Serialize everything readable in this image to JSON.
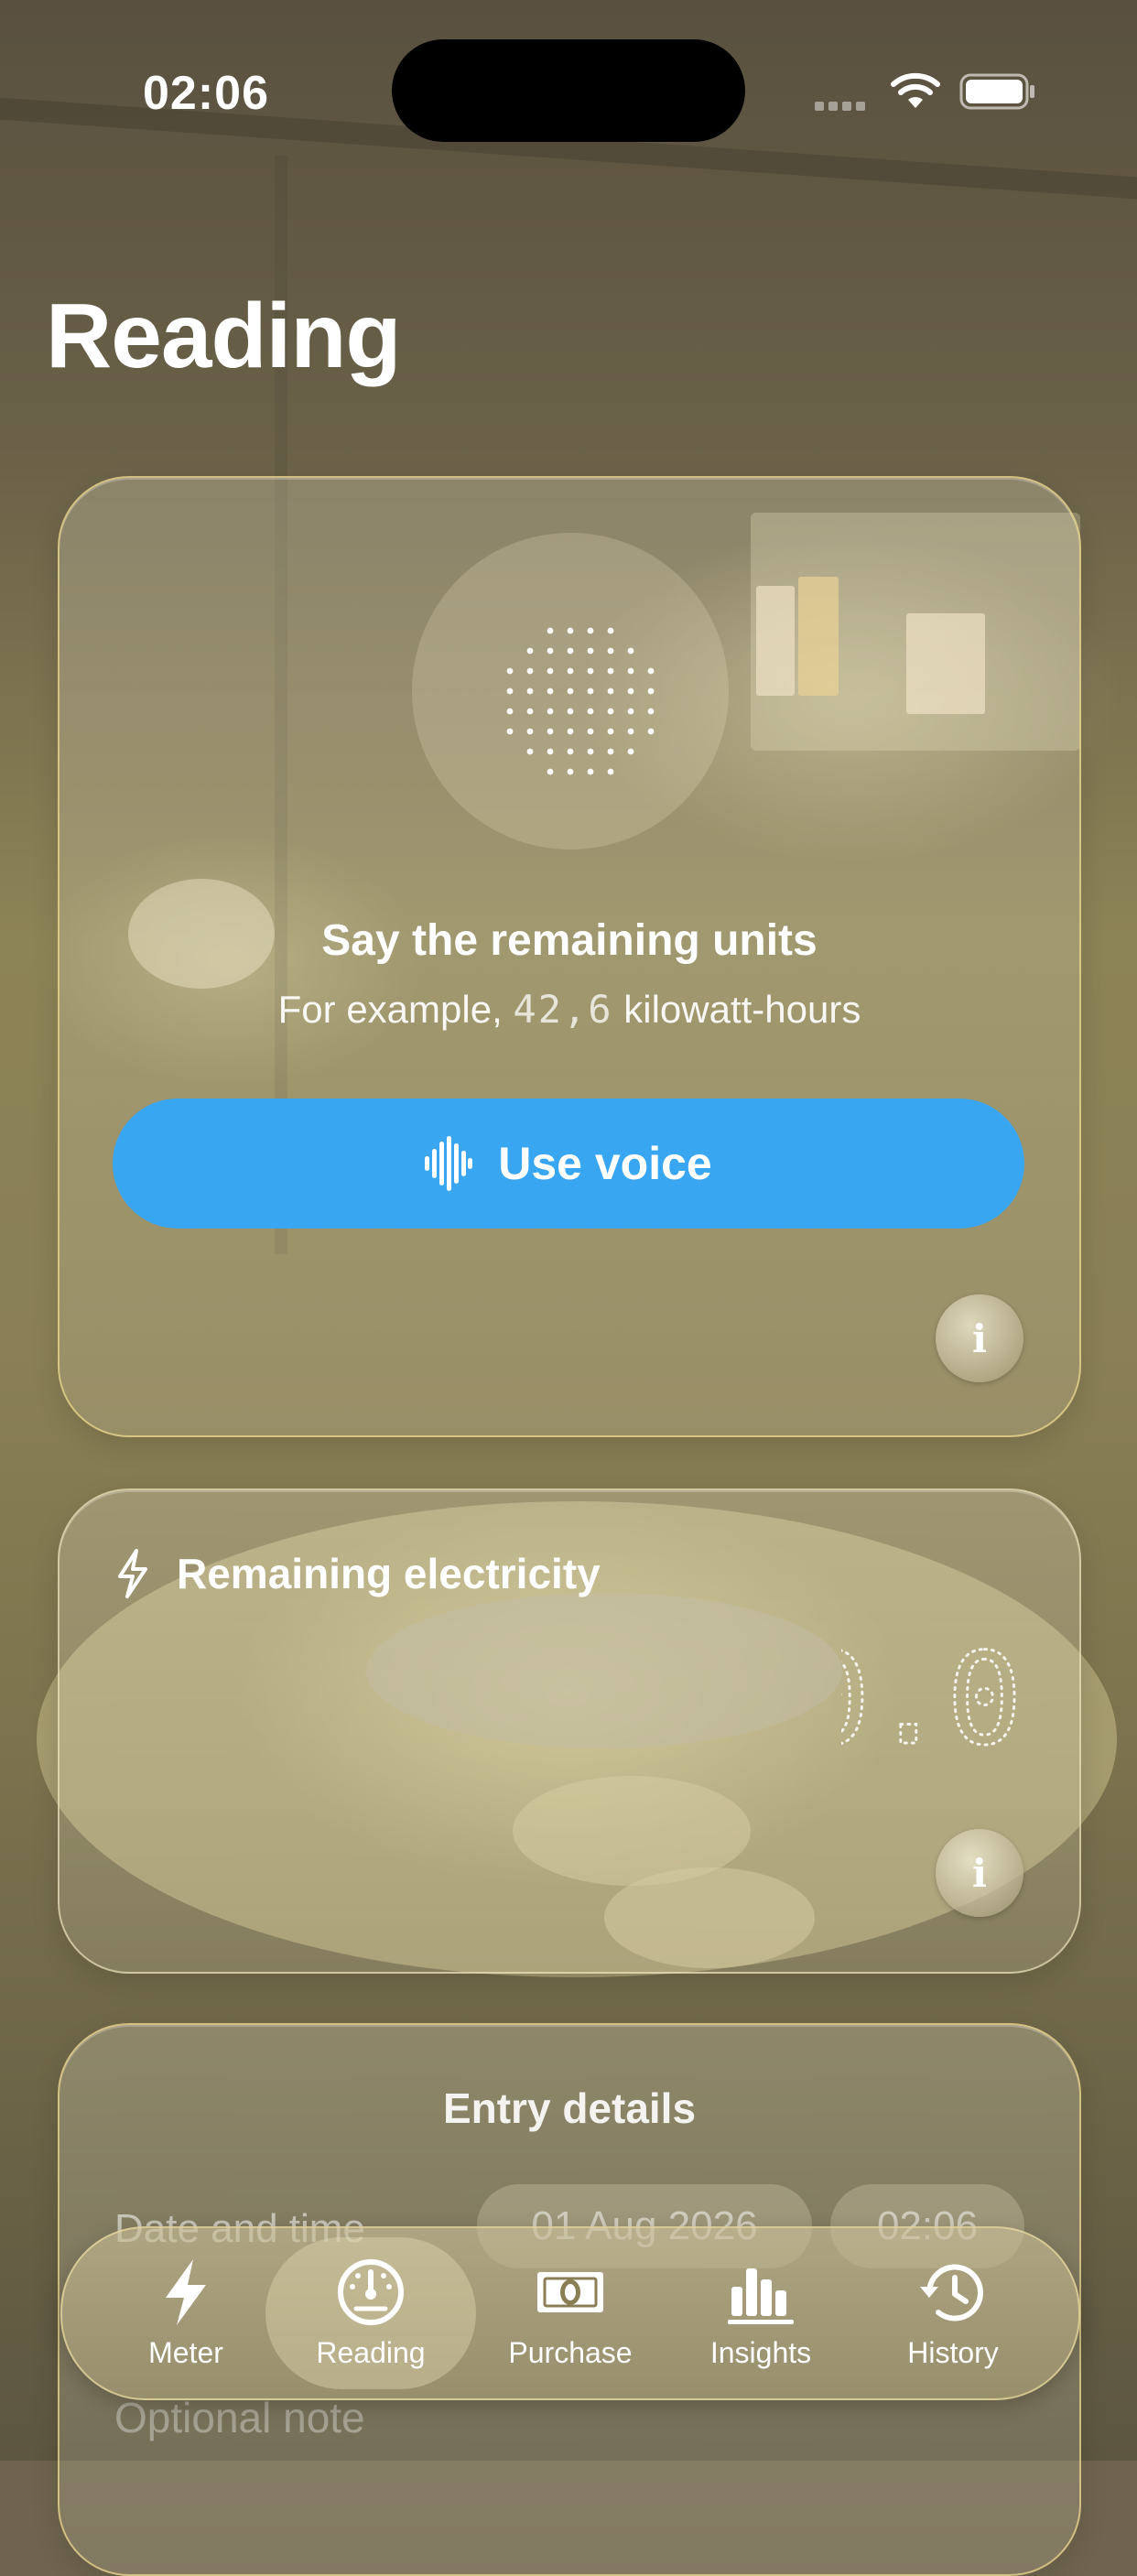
{
  "status_bar": {
    "time": "02:06"
  },
  "header": {
    "title": "Reading"
  },
  "voice_card": {
    "title": "Say the remaining units",
    "subtitle_prefix": "For example, ",
    "subtitle_number": "42,6",
    "subtitle_suffix": " kilowatt-hours",
    "button_label": "Use voice",
    "info_label": "i"
  },
  "remaining_card": {
    "title": "Remaining electricity",
    "value": "0.0",
    "info_label": "i"
  },
  "entry_card": {
    "title": "Entry details",
    "date_label": "Date and time",
    "date_value": "01 Aug 2026",
    "time_value": "02:06",
    "note_placeholder": "Optional note"
  },
  "tabbar": {
    "tabs": [
      {
        "label": "Meter",
        "icon": "bolt-icon",
        "active": false
      },
      {
        "label": "Reading",
        "icon": "gauge-icon",
        "active": true
      },
      {
        "label": "Purchase",
        "icon": "banknote-icon",
        "active": false
      },
      {
        "label": "Insights",
        "icon": "chart-bars-icon",
        "active": false
      },
      {
        "label": "History",
        "icon": "history-clock-icon",
        "active": false
      }
    ]
  },
  "colors": {
    "accent": "#39a6f2",
    "card_border": "#ebd78c"
  }
}
